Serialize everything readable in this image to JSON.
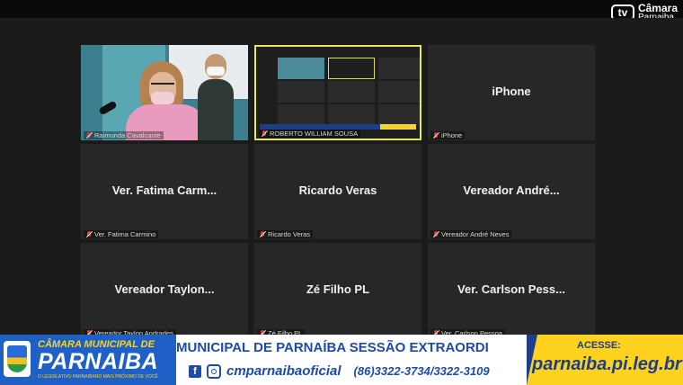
{
  "channel": {
    "badge": "tv",
    "name_line1": "Câmara",
    "name_line2": "Parnaiba"
  },
  "tiles": [
    {
      "display": "",
      "label": "Raimunda Cavalcante",
      "muted": true
    },
    {
      "display": "",
      "label": "ROBERTO WILLIAM SOUSA",
      "muted": true
    },
    {
      "display": "iPhone",
      "label": "iPhone",
      "muted": true
    },
    {
      "display": "Ver. Fatima Carm...",
      "label": "Ver. Fatima Carmino",
      "muted": true
    },
    {
      "display": "Ricardo Veras",
      "label": "Ricardo Veras",
      "muted": true
    },
    {
      "display": "Vereador André...",
      "label": "Vereador André Neves",
      "muted": true
    },
    {
      "display": "Vereador  Taylon...",
      "label": "Vereador Taylon Andrades",
      "muted": true
    },
    {
      "display": "Zé Filho PL",
      "label": "Zé Filho PL",
      "muted": true
    },
    {
      "display": "Ver. Carlson Pess...",
      "label": "Ver. Carlson Pessoa",
      "muted": true
    }
  ],
  "banner": {
    "org_line1": "CÂMARA MUNICIPAL DE",
    "org_line2": "PARNAIBA",
    "slogan": "O LEGISLATIVO PARNAIBANO MAIS PRÓXIMO DE VOCÊ",
    "ticker": "MUNICIPAL DE PARNAÍBA   SESSÃO EXTRAORDI",
    "handle": "cmparnaibaoficial",
    "phone": "(86)3322-3734/3322-3109",
    "acesse": "ACESSE:",
    "url": "parnaiba.pi.leg.br"
  },
  "colors": {
    "banner_blue": "#1e3d8a",
    "banner_yellow": "#ffd21f",
    "active_border": "#e4e85a",
    "muted_mic": "#e53935"
  }
}
